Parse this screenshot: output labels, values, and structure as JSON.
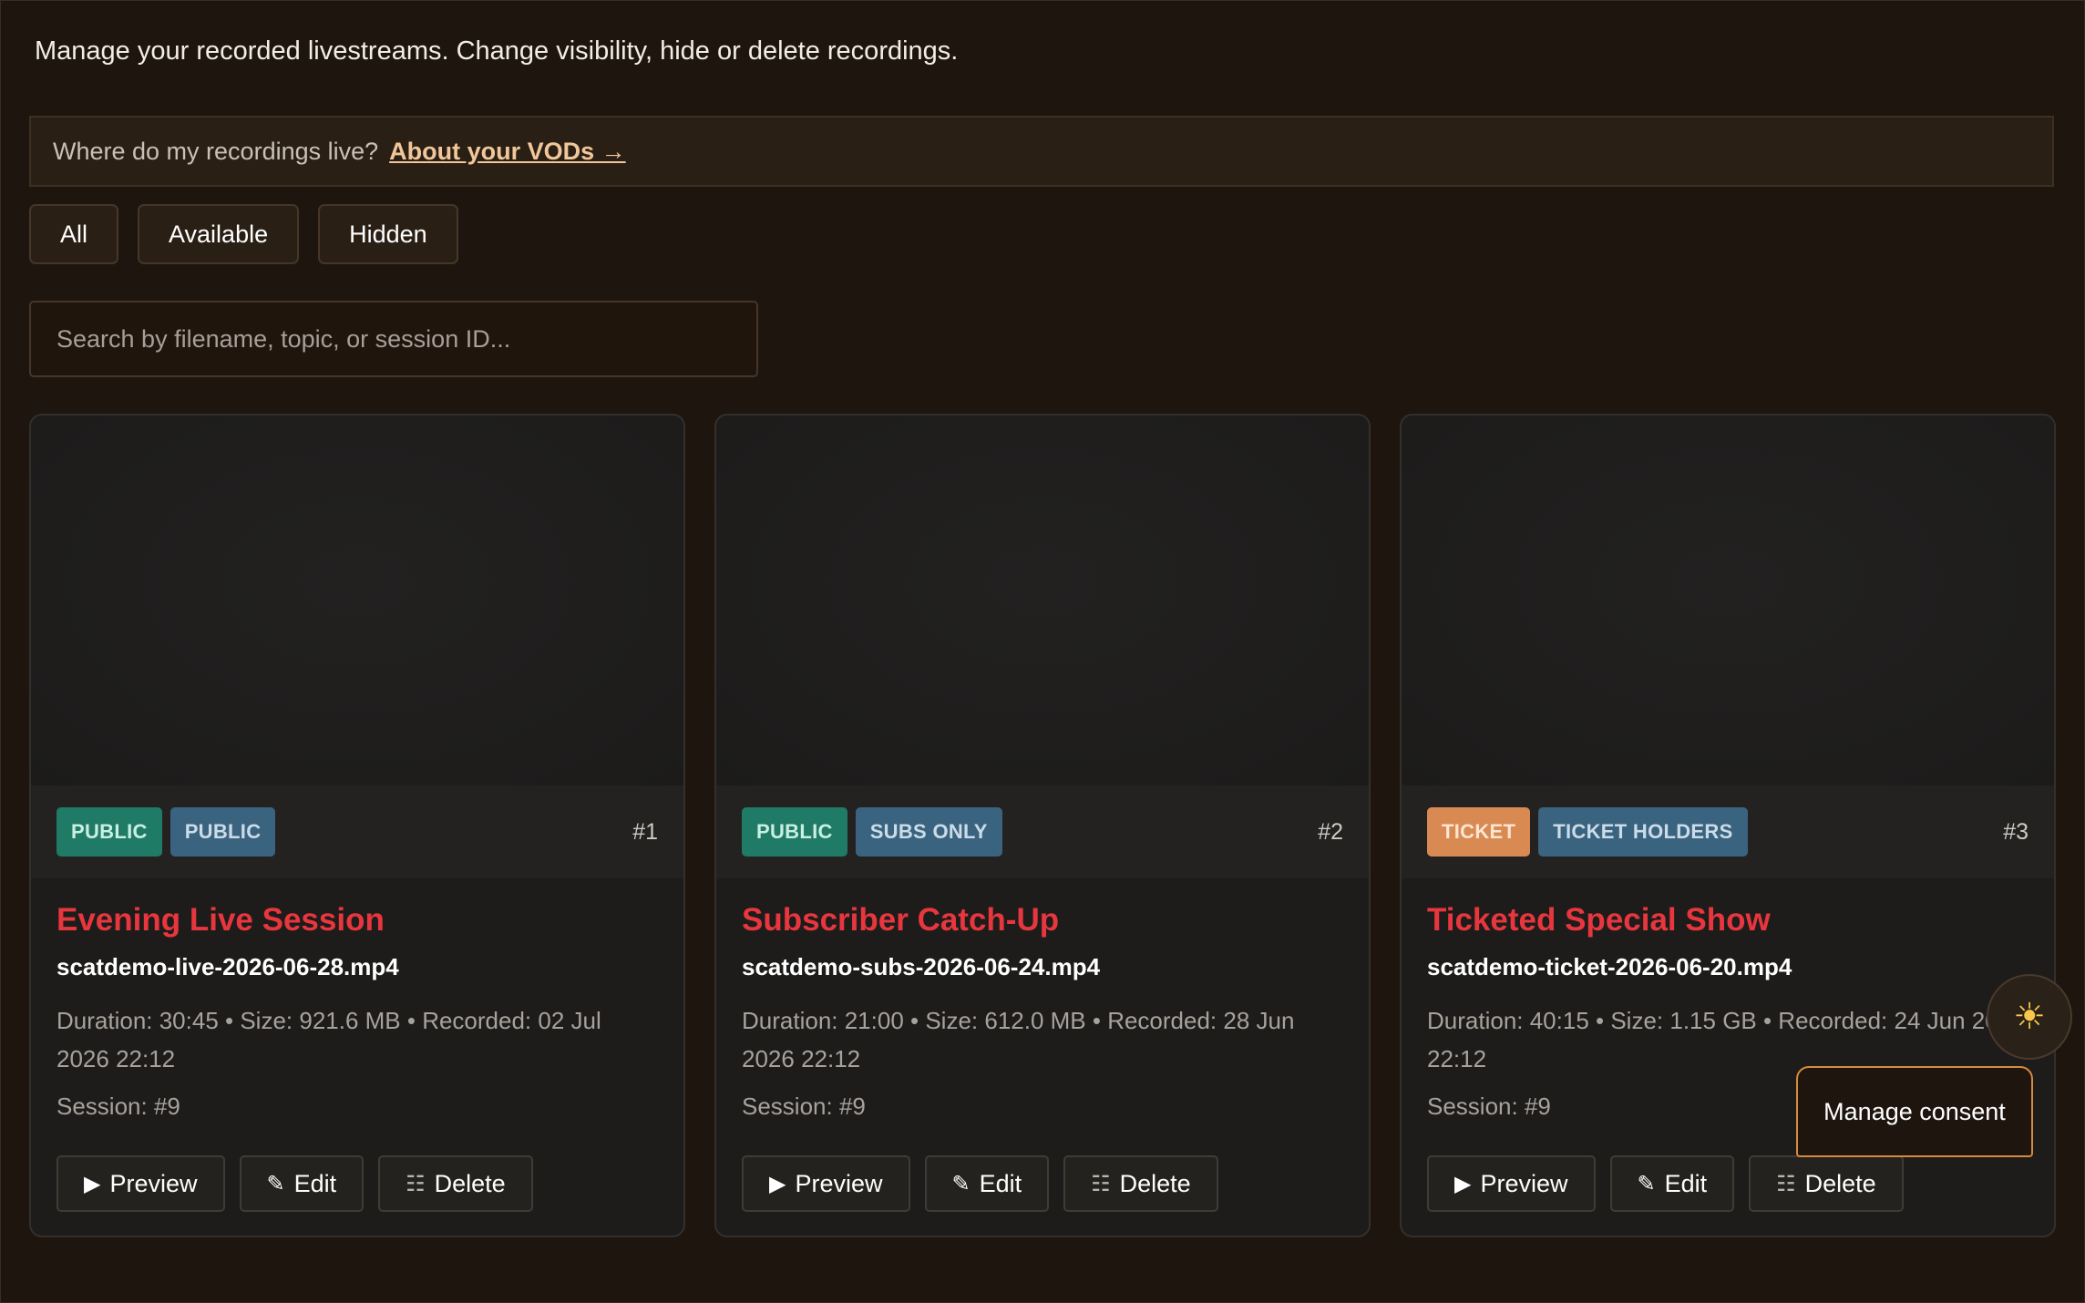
{
  "intro": "Manage your recorded livestreams. Change visibility, hide or delete recordings.",
  "info": {
    "question": "Where do my recordings live?",
    "link": "About your VODs →"
  },
  "filters": [
    "All",
    "Available",
    "Hidden"
  ],
  "search": {
    "placeholder": "Search by filename, topic, or session ID..."
  },
  "cards": [
    {
      "badges": [
        {
          "label": "PUBLIC",
          "color": "#1f7a66"
        },
        {
          "label": "PUBLIC",
          "color": "#3a637f"
        }
      ],
      "number": "#1",
      "title": "Evening Live Session",
      "filename": "scatdemo-live-2026-06-28.mp4",
      "details": "Duration: 30:45 • Size: 921.6 MB • Recorded: 02 Jul 2026 22:12",
      "session": "Session: #9"
    },
    {
      "badges": [
        {
          "label": "PUBLIC",
          "color": "#1f7a66"
        },
        {
          "label": "SUBS ONLY",
          "color": "#3a637f"
        }
      ],
      "number": "#2",
      "title": "Subscriber Catch-Up",
      "filename": "scatdemo-subs-2026-06-24.mp4",
      "details": "Duration: 21:00 • Size: 612.0 MB • Recorded: 28 Jun 2026 22:12",
      "session": "Session: #9"
    },
    {
      "badges": [
        {
          "label": "TICKET",
          "color": "#d88a52"
        },
        {
          "label": "TICKET HOLDERS",
          "color": "#3a637f"
        }
      ],
      "number": "#3",
      "title": "Ticketed Special Show",
      "filename": "scatdemo-ticket-2026-06-20.mp4",
      "details": "Duration: 40:15 • Size: 1.15 GB • Recorded: 24 Jun 2026 22:12",
      "session": "Session: #9"
    }
  ],
  "actions": {
    "preview": "Preview",
    "edit": "Edit",
    "delete": "Delete",
    "preview_icon": "play-icon",
    "edit_icon": "pencil-icon",
    "delete_icon": "trash-icon"
  },
  "theme_toggle_icon": "sun-icon",
  "consent": "Manage consent",
  "colors": {
    "accent_title": "#e8363e",
    "link": "#f1c79a",
    "consent_border": "#d68b3c"
  }
}
